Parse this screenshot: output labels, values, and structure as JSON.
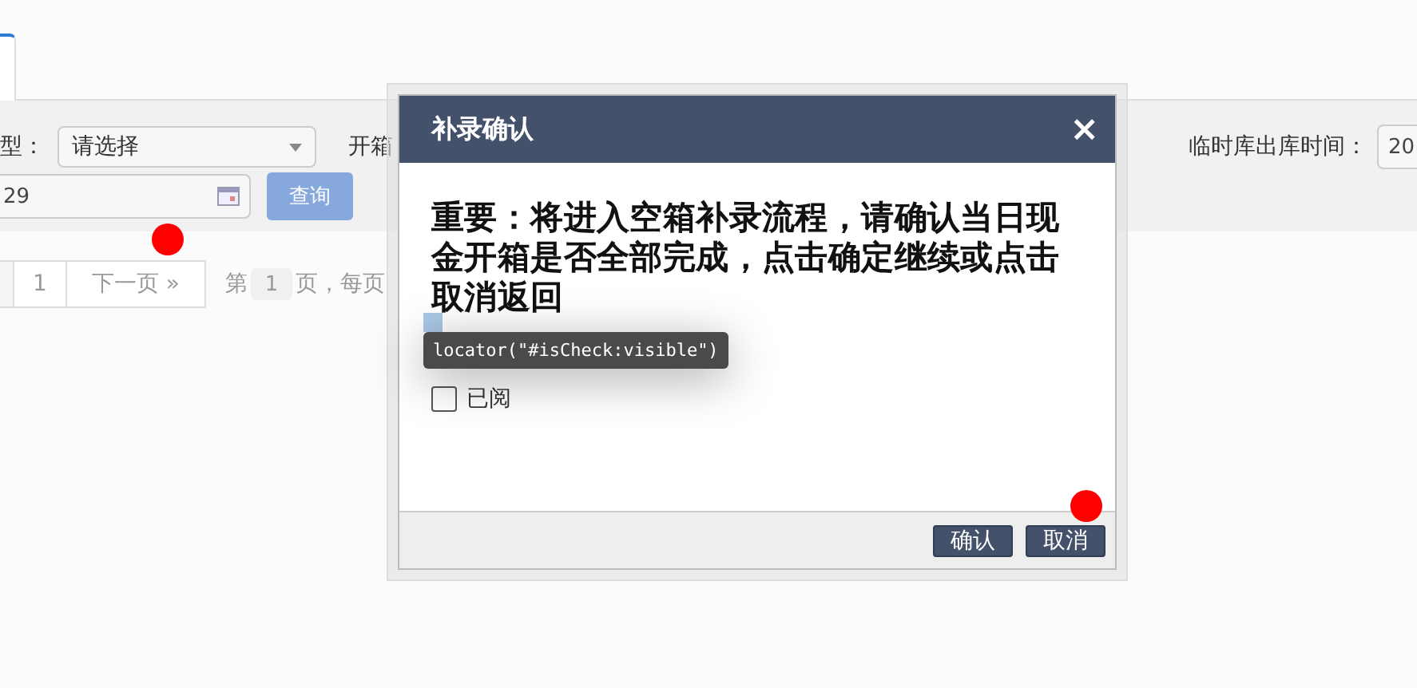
{
  "filter_row": [
    {
      "kind": "label",
      "text": "型："
    },
    {
      "kind": "select",
      "value": "请选择"
    },
    {
      "kind": "label",
      "text": "开箱"
    }
  ],
  "filter_row_right": {
    "label": "临时库出库时间：",
    "value": "20"
  },
  "date_field": {
    "value": "29"
  },
  "query_button": {
    "label": "查询"
  },
  "pager": {
    "page_cell": "1",
    "next": "下一页 »",
    "prefix": "第",
    "page_input": "1",
    "suffix": "页，每页"
  },
  "dialog": {
    "title": "补录确认",
    "close": "×",
    "message": "重要：将进入空箱补录流程，请确认当日现金开箱是否全部完成，点击确定继续或点击取消返回",
    "checkbox": {
      "label": "已阅",
      "checked": false
    },
    "buttons": [
      "确认",
      "取消"
    ]
  },
  "tooltip": "locator(\"#isCheck:visible\")"
}
